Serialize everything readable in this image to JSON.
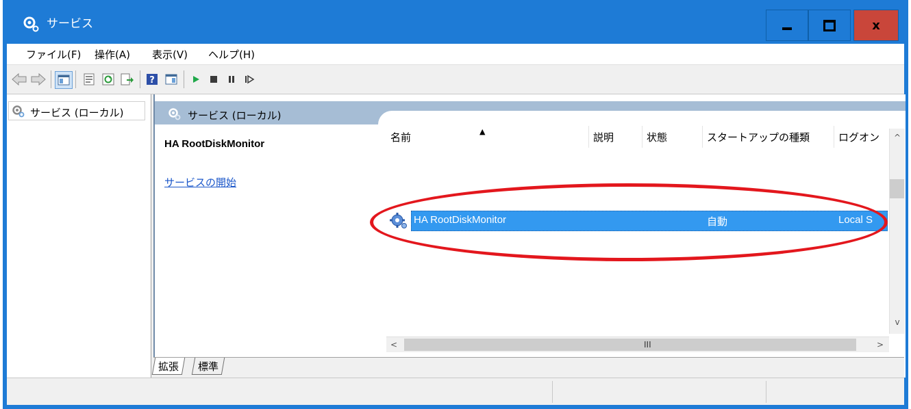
{
  "window": {
    "title": "サービス",
    "close_label": "x",
    "accent_color": "#1e7bd6",
    "close_color": "#c9463a"
  },
  "menu": {
    "items": [
      "ファイル(F)",
      "操作(A)",
      "表示(V)",
      "ヘルプ(H)"
    ]
  },
  "toolbar": {
    "icons": [
      "back-arrow-icon",
      "forward-arrow-icon",
      "console-tree-icon",
      "properties-icon",
      "refresh-icon",
      "export-list-icon",
      "help-icon",
      "action-pane-icon",
      "play-icon",
      "stop-icon",
      "pause-icon",
      "resume-icon"
    ]
  },
  "tree": {
    "item_label": "サービス (ローカル)"
  },
  "pane": {
    "header_title": "サービス (ローカル)",
    "detail_title": "HA RootDiskMonitor",
    "detail_link": "サービスの開始"
  },
  "list": {
    "columns": [
      "名前",
      "説明",
      "状態",
      "スタートアップの種類",
      "ログオン"
    ],
    "sort_indicator": "▲",
    "rows": [
      {
        "name": "HA RootDiskMonitor",
        "description": "",
        "status": "",
        "startup_type": "自動",
        "logon": "Local S"
      }
    ],
    "selection_color": "#3399f0"
  },
  "scrollbar": {
    "left_arrow": "<",
    "right_arrow": ">",
    "up_arrow": "^",
    "down_arrow": "v",
    "grip": "III"
  },
  "tabs": [
    "拡張",
    "標準"
  ],
  "annotation": {
    "color": "#e3171d"
  }
}
